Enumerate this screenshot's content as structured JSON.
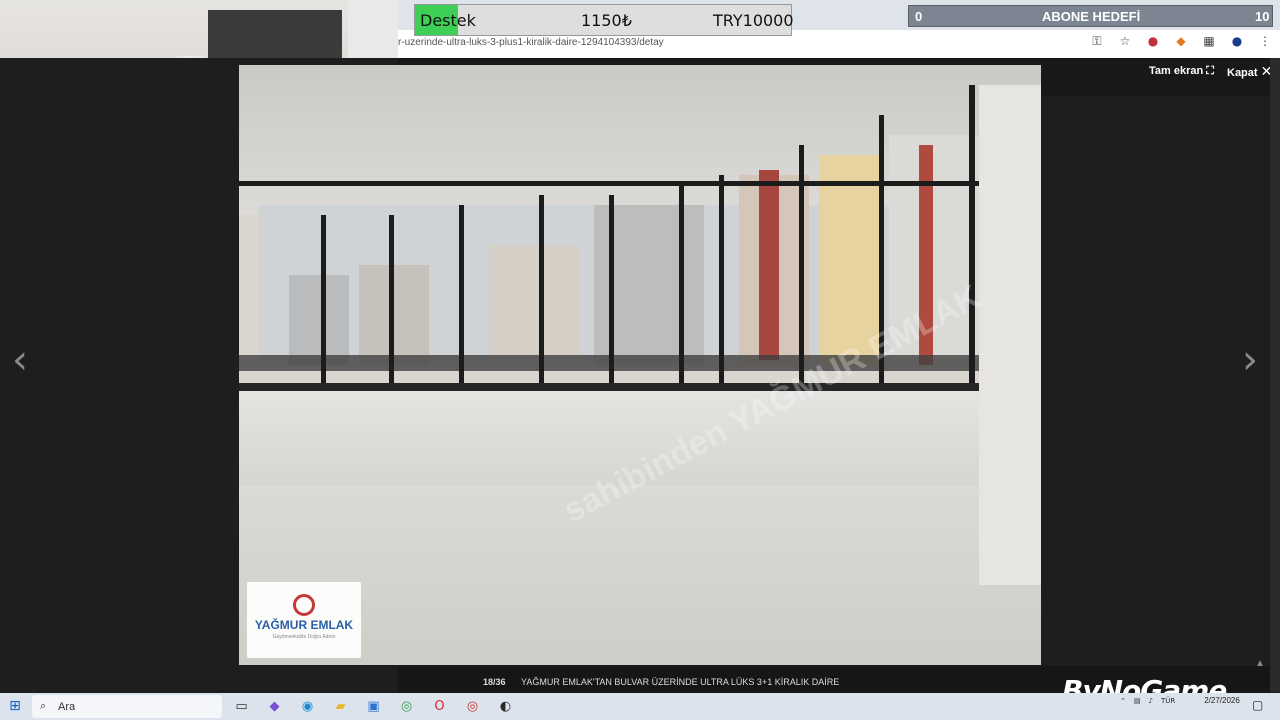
{
  "browser": {
    "url": "r-uzerinde-ultra-luks-3-plus1-kiralik-daire-1294104393/detay",
    "toolbar_icons": [
      "key-icon",
      "star-icon",
      "extension-badge-icon",
      "fox-extension-icon",
      "puzzle-icon",
      "profile-avatar-icon",
      "menu-icon"
    ]
  },
  "overlay": {
    "donation_label": "Destek",
    "donation_current": "1150₺",
    "donation_goal": "TRY10000",
    "donation_progress_fraction": 0.115,
    "subgoal_current": "0",
    "subgoal_label": "ABONE HEDEFİ",
    "subgoal_target": "10"
  },
  "gallery": {
    "fullscreen_label": "Tam ekran",
    "close_label": "Kapat",
    "counter": "18/36",
    "title": "YAĞMUR EMLAK'TAN BULVAR ÜZERİNDE ULTRA LÜKS 3+1 KİRALIK DAİRE",
    "watermark": "sahibinden YAĞMUR EMLAK",
    "logo_name": "YAĞMUR EMLAK",
    "logo_tagline": "Gayrimenkulde Doğru Adres"
  },
  "brand": "ByNoGame",
  "taskbar": {
    "search_placeholder": "Ara",
    "tray_lang": "TÜR",
    "time": "",
    "date": "2/27/2026",
    "apps": [
      {
        "name": "task-view-icon",
        "glyph": "▭",
        "color": "#333333"
      },
      {
        "name": "copilot-icon",
        "glyph": "◆",
        "color": "#7b4fd6"
      },
      {
        "name": "edge-icon",
        "glyph": "◉",
        "color": "#1b8bd6"
      },
      {
        "name": "file-explorer-icon",
        "glyph": "▰",
        "color": "#e8b634"
      },
      {
        "name": "store-icon",
        "glyph": "▣",
        "color": "#2b6fd1"
      },
      {
        "name": "chrome-icon",
        "glyph": "◎",
        "color": "#2f9e44"
      },
      {
        "name": "opera-icon",
        "glyph": "O",
        "color": "#d9262c"
      },
      {
        "name": "chrome-active-icon",
        "glyph": "◎",
        "color": "#c9312b"
      },
      {
        "name": "obs-icon",
        "glyph": "◐",
        "color": "#2a2a2a"
      }
    ]
  }
}
